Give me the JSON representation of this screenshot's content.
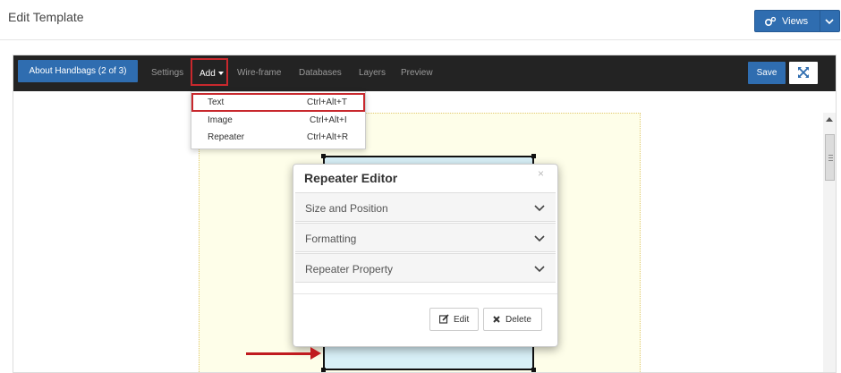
{
  "page": {
    "title": "Edit Template"
  },
  "views_button": {
    "label": "Views",
    "icon": "gears-icon"
  },
  "toolbar": {
    "template_button": "About Handbags (2 of 3)",
    "nav": [
      "Settings",
      "Add",
      "Wire-frame",
      "Databases",
      "Layers",
      "Preview"
    ],
    "save": "Save"
  },
  "add_menu": {
    "items": [
      {
        "label": "Text",
        "shortcut": "Ctrl+Alt+T"
      },
      {
        "label": "Image",
        "shortcut": "Ctrl+Alt+I"
      },
      {
        "label": "Repeater",
        "shortcut": "Ctrl+Alt+R"
      }
    ]
  },
  "repeater_editor": {
    "title": "Repeater Editor",
    "close": "×",
    "sections": [
      "Size and Position",
      "Formatting",
      "Repeater Property"
    ],
    "edit_button": "Edit",
    "delete_button": "Delete"
  },
  "colors": {
    "accent": "#2f6db0",
    "highlight": "#c8282d",
    "toolbar": "#232323"
  }
}
